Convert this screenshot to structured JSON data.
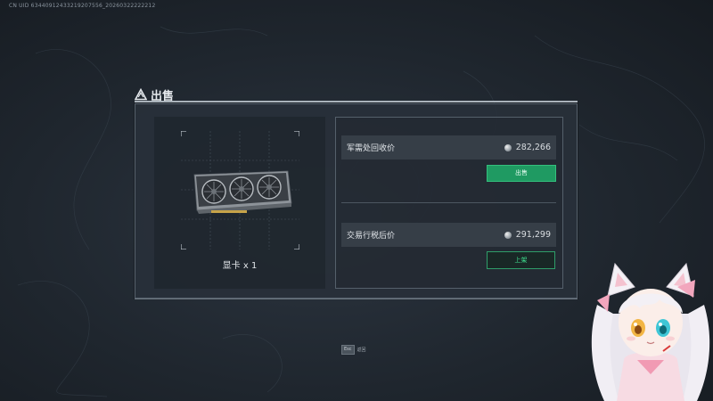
{
  "uid_text": "CN UID 63440912433219207556_20260322222212",
  "dialog": {
    "title": "出售",
    "title_icon": "warning-triangle-icon",
    "item": {
      "name": "显卡 x 1",
      "image": "graphics-card-image"
    },
    "recycle": {
      "label": "军需处回收价",
      "price": "282,266",
      "coin_icon": "silver-coin-icon",
      "button_label": "出售"
    },
    "market": {
      "label": "交易行税后价",
      "price": "291,299",
      "coin_icon": "silver-coin-icon",
      "button_label": "上架"
    }
  },
  "footer": {
    "key": "Esc",
    "label": "返回"
  },
  "colors": {
    "accent_green": "#1f9a62",
    "list_green": "#3fe08f",
    "background": "#1f262e"
  }
}
